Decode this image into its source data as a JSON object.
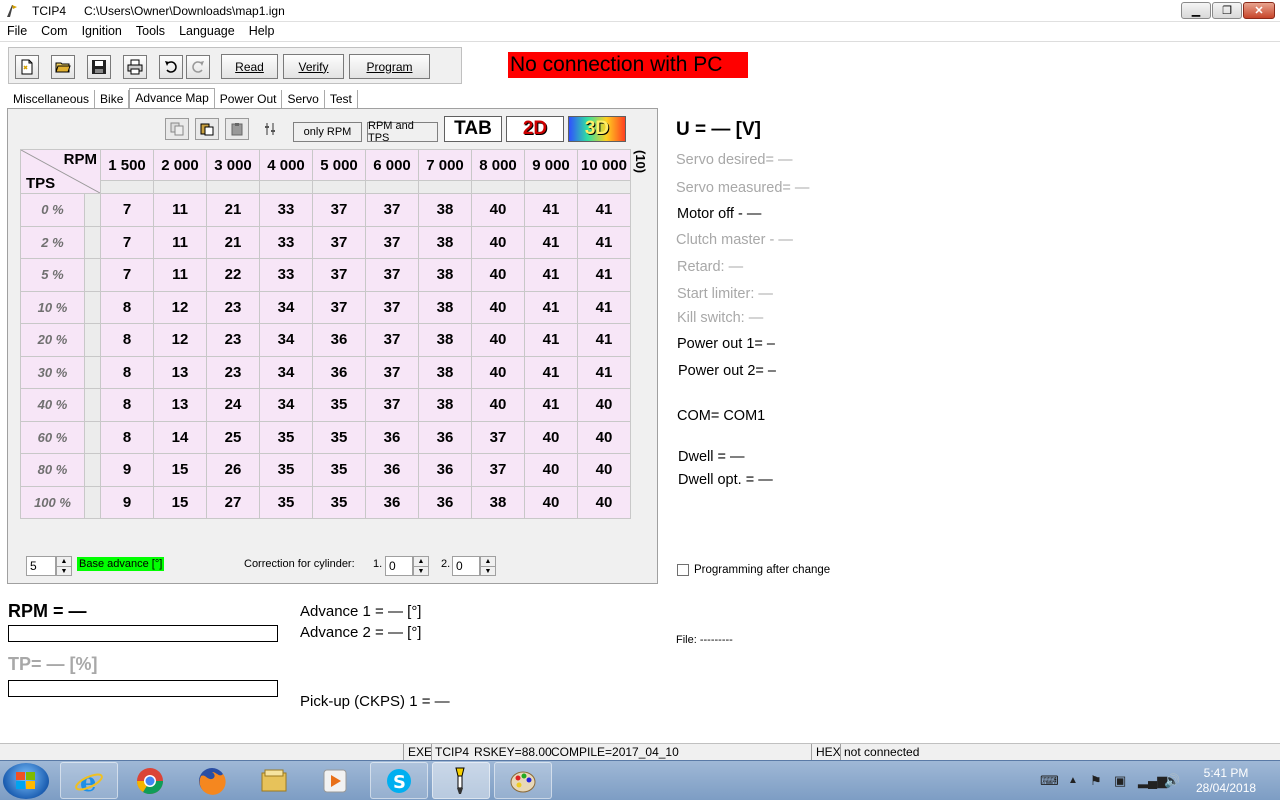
{
  "window": {
    "app_name": "TCIP4",
    "path": "C:\\Users\\Owner\\Downloads\\map1.ign"
  },
  "menu": [
    "File",
    "Com",
    "Ignition",
    "Tools",
    "Language",
    "Help"
  ],
  "toolbar": {
    "read_label": "Read",
    "verify_label": "Verify",
    "program_label": "Program"
  },
  "status_banner": "No connection with PC",
  "tabs": [
    "Miscellaneous",
    "Bike",
    "Advance Map",
    "Power Out",
    "Servo",
    "Test"
  ],
  "map_controls": {
    "only_rpm": "only RPM",
    "rpm_tps": "RPM and TPS",
    "tab": "TAB",
    "two_d": "2D",
    "three_d": "3D"
  },
  "grid": {
    "rpm_label": "RPM",
    "tps_label": "TPS",
    "unit_label": "(10)",
    "rpm": [
      "1 500",
      "2 000",
      "3 000",
      "4 000",
      "5 000",
      "6 000",
      "7 000",
      "8 000",
      "9 000",
      "10 000"
    ],
    "tps": [
      "0 %",
      "2 %",
      "5 %",
      "10 %",
      "20 %",
      "30 %",
      "40 %",
      "60 %",
      "80 %",
      "100 %"
    ],
    "values": [
      [
        7,
        11,
        21,
        33,
        37,
        37,
        38,
        40,
        41,
        41
      ],
      [
        7,
        11,
        21,
        33,
        37,
        37,
        38,
        40,
        41,
        41
      ],
      [
        7,
        11,
        22,
        33,
        37,
        37,
        38,
        40,
        41,
        41
      ],
      [
        8,
        12,
        23,
        34,
        37,
        37,
        38,
        40,
        41,
        41
      ],
      [
        8,
        12,
        23,
        34,
        36,
        37,
        38,
        40,
        41,
        41
      ],
      [
        8,
        13,
        23,
        34,
        36,
        37,
        38,
        40,
        41,
        41
      ],
      [
        8,
        13,
        24,
        34,
        35,
        37,
        38,
        40,
        41,
        40
      ],
      [
        8,
        14,
        25,
        35,
        35,
        36,
        36,
        37,
        40,
        40
      ],
      [
        9,
        15,
        26,
        35,
        35,
        36,
        36,
        37,
        40,
        40
      ],
      [
        9,
        15,
        27,
        35,
        35,
        36,
        36,
        38,
        40,
        40
      ]
    ]
  },
  "controls": {
    "base_advance_value": "5",
    "base_advance_label": "Base advance [°]",
    "correction_label": "Correction for cylinder:",
    "cyl1_label": "1.",
    "cyl1_value": "0",
    "cyl2_label": "2.",
    "cyl2_value": "0"
  },
  "info": {
    "voltage": "U = — [V]",
    "servo_desired": "Servo desired= —",
    "servo_measured": "Servo measured= —",
    "motor_off": "Motor off - —",
    "clutch_master": "Clutch master - —",
    "retard": "Retard: —",
    "start_limiter": "Start limiter: —",
    "kill_switch": "Kill switch: —",
    "power_out_1": "Power out 1= –",
    "power_out_2": "Power out 2= –",
    "com": "COM= COM1",
    "dwell": "Dwell = —",
    "dwell_opt": "Dwell opt. = —",
    "programming_after_change": "Programming after change",
    "file": "File:  ---------"
  },
  "readouts": {
    "rpm": "RPM = —",
    "tp": "TP= — [%]",
    "advance1": "Advance 1 = — [°]",
    "advance2": "Advance 2 = — [°]",
    "pickup": "Pick-up (CKPS) 1 = —"
  },
  "statusbar": {
    "exe": "EXE",
    "exe_name": "TCIP4",
    "rskey": "RSKEY=88.00",
    "compile": "COMPILE=2017_04_10",
    "hex": "HEX",
    "hex_status": "not connected"
  },
  "clock": {
    "time": "5:41 PM",
    "date": "28/04/2018"
  }
}
